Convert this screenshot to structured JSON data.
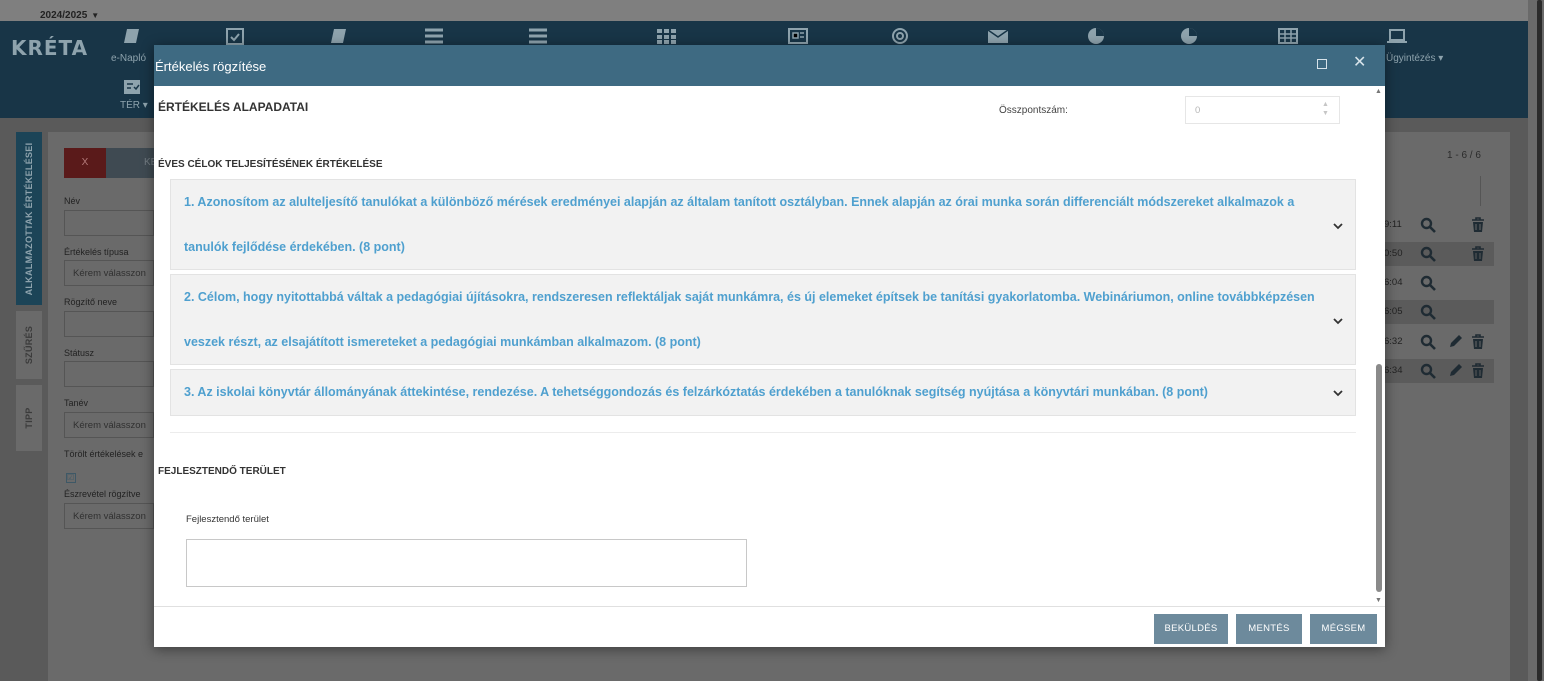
{
  "top": {
    "year": "2024/2025"
  },
  "nav": {
    "logo": "KRÉTA",
    "enaplo_label": "e-Napló",
    "ter_label": "TÉR",
    "ugyintezes_label": "Ügyintézés"
  },
  "side_tabs": {
    "alkalmazottak": "ALKALMAZOTTAK ÉRTÉKELÉSEI",
    "szures": "SZŰRÉS",
    "tipp": "TIPP"
  },
  "filter": {
    "x_button": "X",
    "k_button": "KE",
    "nev_label": "Név",
    "tipus_label": "Értékelés típusa",
    "tipus_value": "Kérem válasszon",
    "rogzito_label": "Rögzítő neve",
    "statusz_label": "Státusz",
    "tanev_label": "Tanév",
    "tanev_value": "Kérem válasszon",
    "torolt_label": "Törölt értékelések e",
    "torolt_check": "☑",
    "eszrevetel_label": "Észrevétel rögzítve",
    "eszrevetel_value": "Kérem válasszon"
  },
  "results": {
    "count": "1 - 6 / 6",
    "rows": [
      {
        "time": "9:11"
      },
      {
        "time": "0:50"
      },
      {
        "time": "6:04"
      },
      {
        "time": "6:05"
      },
      {
        "time": "6:32"
      },
      {
        "time": "6:34"
      }
    ]
  },
  "modal": {
    "title": "Értékelés rögzítése",
    "section_title": "ÉRTÉKELÉS ALAPADATAI",
    "osszpontszam_label": "Összpontszám:",
    "osszpontszam_value": "0",
    "goals_heading": "ÉVES CÉLOK TELJESÍTÉSÉNEK ÉRTÉKELÉSE",
    "goals": [
      {
        "text": "1. Azonosítom az alulteljesítő tanulókat a különböző mérések eredményei alapján az általam tanított osztályban. Ennek alapján az órai munka során differenciált módszereket alkalmazok a tanulók fejlődése érdekében. (8 pont)"
      },
      {
        "text": "2. Célom, hogy nyitottabbá váltak a pedagógiai újításokra, rendszeresen reflektáljak saját munkámra, és új elemeket építsek be tanítási gyakorlatomba. Webináriumon, online továbbképzésen veszek részt, az elsajátított ismereteket a pedagógiai munkámban alkalmazom. (8 pont)"
      },
      {
        "text": "3. Az iskolai könyvtár állományának áttekintése, rendezése. A tehetséggondozás és felzárkóztatás érdekében a tanulóknak segítség nyújtása a könyvtári munkában. (8 pont)"
      }
    ],
    "fejlesztendo_heading": "FEJLESZTENDŐ TERÜLET",
    "fejlesztendo_label": "Fejlesztendő terület",
    "fejlesztendo_value": "",
    "buttons": {
      "bekuldes": "BEKÜLDÉS",
      "mentes": "MENTÉS",
      "megsem": "MÉGSEM"
    }
  },
  "colors": {
    "nav_bg": "#183547",
    "modal_header": "#3e6a82",
    "goal_text": "#4fa0cf",
    "button_bg": "#6d8a9c"
  }
}
